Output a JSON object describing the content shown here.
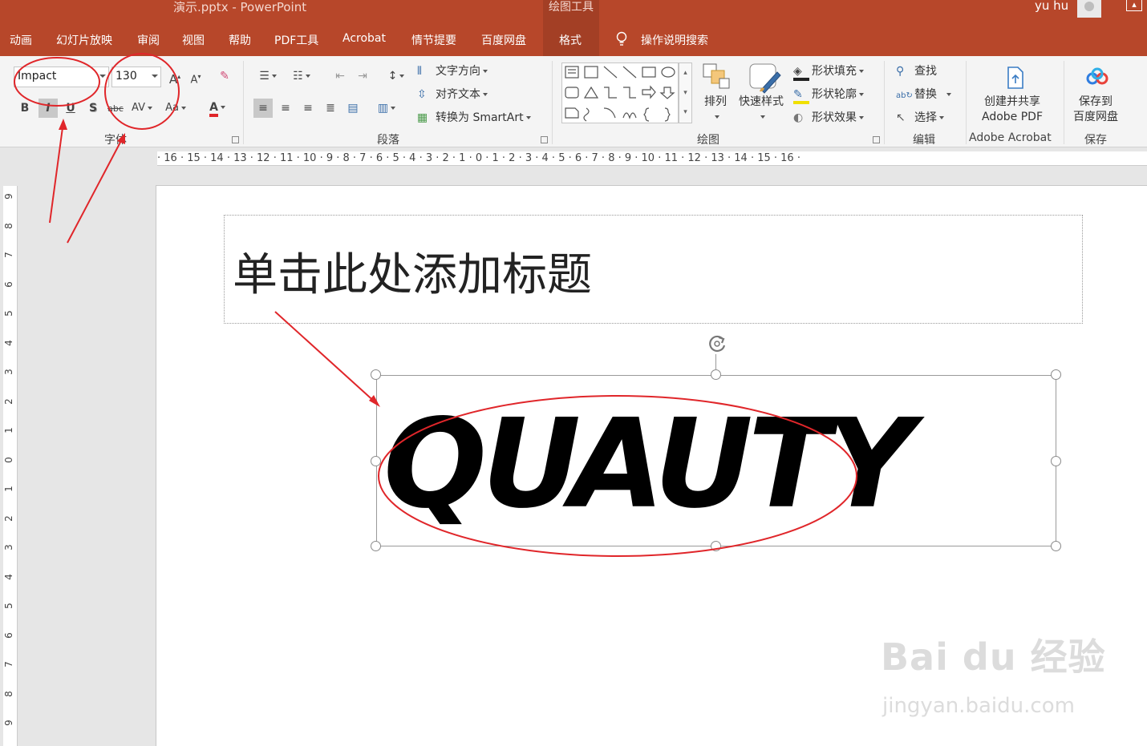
{
  "window": {
    "title": "演示.pptx  -  PowerPoint",
    "contextual_tab_group": "绘图工具",
    "user": "yu hu"
  },
  "tabs": [
    {
      "label": "动画"
    },
    {
      "label": "幻灯片放映"
    },
    {
      "label": "审阅"
    },
    {
      "label": "视图"
    },
    {
      "label": "帮助"
    },
    {
      "label": "PDF工具"
    },
    {
      "label": "Acrobat"
    },
    {
      "label": "情节提要"
    },
    {
      "label": "百度网盘"
    },
    {
      "label": "格式"
    }
  ],
  "tell_me": "操作说明搜索",
  "ribbon": {
    "font": {
      "group_label": "字体",
      "font_name": "Impact",
      "font_size": "130",
      "bold": "B",
      "italic": "I",
      "underline": "U",
      "shadow": "S",
      "strike": "abc",
      "spacing": "AV",
      "case": "Aa",
      "color": "A",
      "grow": "A",
      "shrink": "A"
    },
    "paragraph": {
      "group_label": "段落",
      "text_direction": "文字方向",
      "align_text": "对齐文本",
      "smartart": "转换为 SmartArt"
    },
    "drawing": {
      "group_label": "绘图",
      "arrange": "排列",
      "quick_styles": "快速样式",
      "shape_fill": "形状填充",
      "shape_outline": "形状轮廓",
      "shape_effects": "形状效果"
    },
    "editing": {
      "group_label": "编辑",
      "find": "查找",
      "replace": "替换",
      "select": "选择"
    },
    "acrobat": {
      "group_label": "Adobe Acrobat",
      "create_share_line1": "创建并共享",
      "create_share_line2": "Adobe PDF"
    },
    "save": {
      "group_label": "保存",
      "save_line1": "保存到",
      "save_line2": "百度网盘"
    }
  },
  "hruler_text": "· 16 · 15 · 14 · 13 · 12 · 11 · 10 · 9 · 8 · 7 · 6 · 5 · 4 · 3 · 2 · 1 · 0 · 1 · 2 · 3 · 4 · 5 · 6 · 7 · 8 · 9 · 10 · 11 · 12 · 13 · 14 · 15 · 16 ·",
  "vruler_numbers": [
    "9",
    "8",
    "7",
    "6",
    "5",
    "4",
    "3",
    "2",
    "1",
    "0",
    "1",
    "2",
    "3",
    "4",
    "5",
    "6",
    "7",
    "8",
    "9"
  ],
  "slide": {
    "title_placeholder": "单击此处添加标题",
    "wordart_text": "QUAUTY"
  },
  "watermark": {
    "brand": "Bai du 经验",
    "url": "jingyan.baidu.com"
  },
  "colors": {
    "accent": "#b7472a",
    "annotation": "#e0262a"
  }
}
